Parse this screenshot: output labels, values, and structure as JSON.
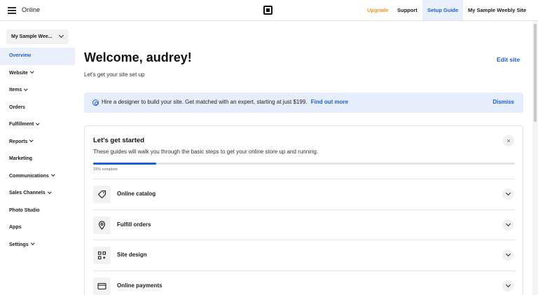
{
  "topbar": {
    "app_name": "Online",
    "upgrade": "Upgrade",
    "support": "Support",
    "setup_guide": "Setup Guide",
    "site_name": "My Sample Weebly Site"
  },
  "sidebar": {
    "site_selector": "My Sample Wee...",
    "items": [
      {
        "label": "Overview",
        "active": true,
        "has_caret": false
      },
      {
        "label": "Website",
        "active": false,
        "has_caret": true
      },
      {
        "label": "Items",
        "active": false,
        "has_caret": true
      },
      {
        "label": "Orders",
        "active": false,
        "has_caret": false
      },
      {
        "label": "Fulfillment",
        "active": false,
        "has_caret": true
      },
      {
        "label": "Reports",
        "active": false,
        "has_caret": true
      },
      {
        "label": "Marketing",
        "active": false,
        "has_caret": false
      },
      {
        "label": "Communications",
        "active": false,
        "has_caret": true
      },
      {
        "label": "Sales Channels",
        "active": false,
        "has_caret": true
      },
      {
        "label": "Photo Studio",
        "active": false,
        "has_caret": false
      },
      {
        "label": "Apps",
        "active": false,
        "has_caret": false
      },
      {
        "label": "Settings",
        "active": false,
        "has_caret": true
      }
    ]
  },
  "main": {
    "welcome": "Welcome, audrey!",
    "subtitle": "Let's get your site set up",
    "edit_site": "Edit site",
    "banner": {
      "text": "Hire a designer to build your site. Get matched with an expert, starting at just $199.",
      "link": "Find out more",
      "dismiss": "Dismiss"
    },
    "card": {
      "title": "Let's get started",
      "description": "These guides will walk you through the basic steps to get your online store up and running.",
      "progress_percent": 15,
      "progress_label": "15% complete",
      "close": "×",
      "tasks": [
        {
          "label": "Online catalog",
          "icon": "tag-icon"
        },
        {
          "label": "Fulfill orders",
          "icon": "location-pin-icon"
        },
        {
          "label": "Site design",
          "icon": "layout-grid-icon"
        },
        {
          "label": "Online payments",
          "icon": "credit-card-icon"
        }
      ]
    }
  },
  "colors": {
    "accent": "#1e5ed8",
    "upgrade": "#f09a1c",
    "active_bg": "#eaf0fb",
    "banner_bg": "#e6eefb"
  }
}
